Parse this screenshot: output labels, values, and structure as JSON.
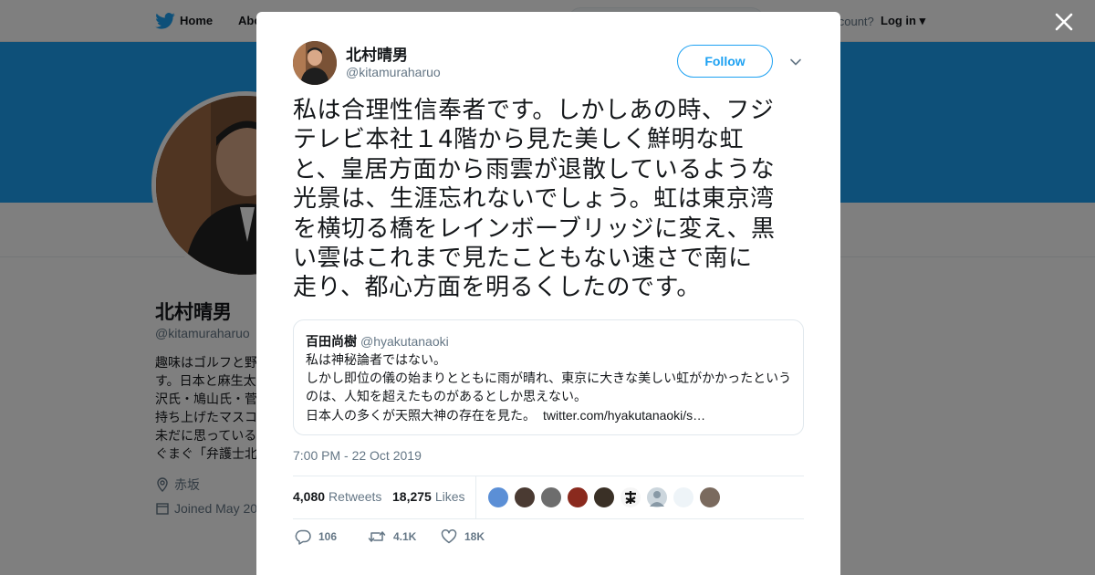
{
  "topbar": {
    "home_label": "Home",
    "about_label": "Abo",
    "account_prompt": "account?",
    "login_label": "Log in"
  },
  "profile": {
    "name": "北村晴男",
    "handle": "@kitamuraharuo",
    "bio_lines": [
      "趣味はゴルフと野",
      "す。日本と麻生太",
      "沢氏・鳩山氏・菅",
      "持ち上げたマスコ",
      "未だに思っている",
      "ぐまぐ「弁護士北"
    ],
    "location": "赤坂",
    "joined": "Joined May 20"
  },
  "tweet": {
    "author_name": "北村晴男",
    "author_handle": "@kitamuraharuo",
    "follow_label": "Follow",
    "text_lines": [
      "私は合理性信奉者です。しかしあの時、フジ",
      "テレビ本社１4階から見た美しく鮮明な虹",
      "と、皇居方面から雨雲が退散しているような",
      "光景は、生涯忘れないでしょう。虹は東京湾",
      "を横切る橋をレインボーブリッジに変え、黒",
      "い雲はこれまで見たこともない速さで南に",
      "走り、都心方面を明るくしたのです。"
    ],
    "timestamp": "7:00 PM - 22 Oct 2019",
    "retweets_count": "4,080",
    "retweets_label": "Retweets",
    "likes_count": "18,275",
    "likes_label": "Likes",
    "reply_count": "106",
    "retweet_count_short": "4.1K",
    "like_count_short": "18K"
  },
  "quote": {
    "name": "百田尚樹",
    "handle": "@hyakutanaoki",
    "lines": [
      "私は神秘論者ではない。",
      "しかし即位の儀の始まりとともに雨が晴れ、東京に大きな美しい虹がかかったという",
      "のは、人知を超えたものがあるとしか思えない。",
      "日本人の多くが天照大神の存在を見た。"
    ],
    "link": "twitter.com/hyakutanaoki/s…"
  },
  "colors": {
    "accent": "#1da1f2",
    "text": "#14171a",
    "muted": "#657786",
    "border": "#e6ecf0"
  }
}
